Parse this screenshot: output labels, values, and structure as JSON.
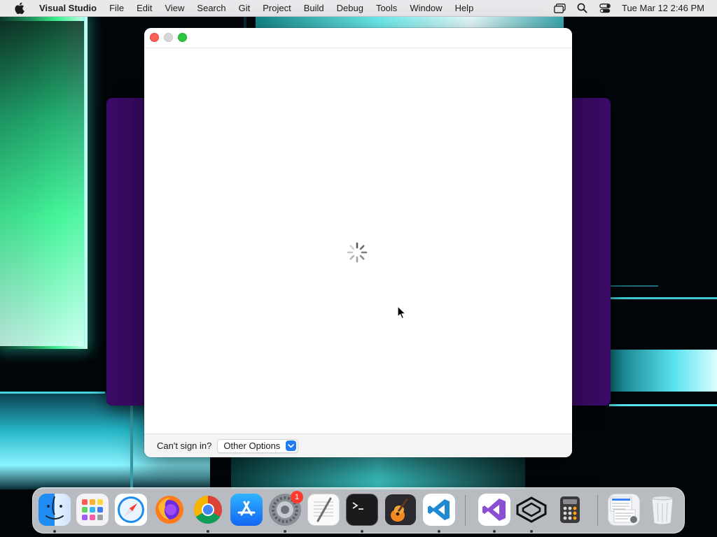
{
  "menubar": {
    "app_name": "Visual Studio",
    "items": [
      "File",
      "Edit",
      "View",
      "Search",
      "Git",
      "Project",
      "Build",
      "Debug",
      "Tools",
      "Window",
      "Help"
    ],
    "clock": "Tue Mar 12  2:46 PM",
    "status_icons": [
      "window-stack-icon",
      "spotlight-search-icon",
      "control-center-icon"
    ]
  },
  "window": {
    "state": "loading",
    "footer": {
      "cant_sign_in": "Can't sign in?",
      "options_select": "Other Options"
    }
  },
  "dock": {
    "apps": [
      {
        "name": "Finder",
        "icon": "finder-icon",
        "running": true
      },
      {
        "name": "Launchpad",
        "icon": "launchpad-icon",
        "running": false
      },
      {
        "name": "Safari",
        "icon": "safari-icon",
        "running": false
      },
      {
        "name": "Firefox",
        "icon": "firefox-icon",
        "running": false
      },
      {
        "name": "Chrome",
        "icon": "chrome-icon",
        "running": true
      },
      {
        "name": "App Store",
        "icon": "app-store-icon",
        "running": false
      },
      {
        "name": "System Settings",
        "icon": "system-settings-icon",
        "running": true,
        "badge": "1"
      },
      {
        "name": "TextEdit",
        "icon": "textedit-icon",
        "running": false
      },
      {
        "name": "Terminal",
        "icon": "terminal-icon",
        "running": true
      },
      {
        "name": "GarageBand",
        "icon": "garageband-icon",
        "running": false
      },
      {
        "name": "VS Code",
        "icon": "vscode-icon",
        "running": true
      },
      {
        "name": "Visual Studio",
        "icon": "visual-studio-icon",
        "running": true
      },
      {
        "name": "Unity Hub",
        "icon": "unity-icon",
        "running": true
      },
      {
        "name": "Calculator",
        "icon": "calculator-icon",
        "running": false
      },
      {
        "name": "Downloads",
        "icon": "downloads-stack-icon",
        "running": false
      },
      {
        "name": "Trash",
        "icon": "trash-icon",
        "running": false
      }
    ]
  },
  "colors": {
    "accent": "#1f7cf5",
    "close": "#fe5f57",
    "maximize": "#29c840",
    "badge": "#ff3b30",
    "purple_window": "#3a0a64"
  }
}
